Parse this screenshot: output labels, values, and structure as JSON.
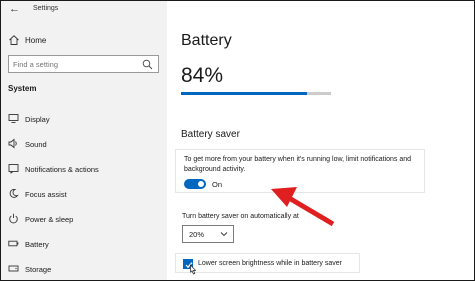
{
  "window": {
    "title": "Settings"
  },
  "sidebar": {
    "home_label": "Home",
    "search_placeholder": "Find a setting",
    "section_label": "System",
    "items": [
      {
        "label": "Display",
        "icon": "monitor-icon"
      },
      {
        "label": "Sound",
        "icon": "speaker-icon"
      },
      {
        "label": "Notifications & actions",
        "icon": "notifications-icon"
      },
      {
        "label": "Focus assist",
        "icon": "moon-icon"
      },
      {
        "label": "Power & sleep",
        "icon": "power-icon"
      },
      {
        "label": "Battery",
        "icon": "battery-icon"
      },
      {
        "label": "Storage",
        "icon": "storage-icon"
      }
    ]
  },
  "main": {
    "title": "Battery",
    "percent_text": "84%",
    "percent_value": 84,
    "saver_heading": "Battery saver",
    "saver_description": "To get more from your battery when it's running low, limit notifications and background activity.",
    "toggle_label": "On",
    "toggle_on": true,
    "auto_label": "Turn battery saver on automatically at",
    "auto_value": "20%",
    "brightness_label": "Lower screen brightness while in battery saver",
    "brightness_checked": true
  },
  "colors": {
    "accent": "#0067c0",
    "arrow": "#e02020"
  }
}
